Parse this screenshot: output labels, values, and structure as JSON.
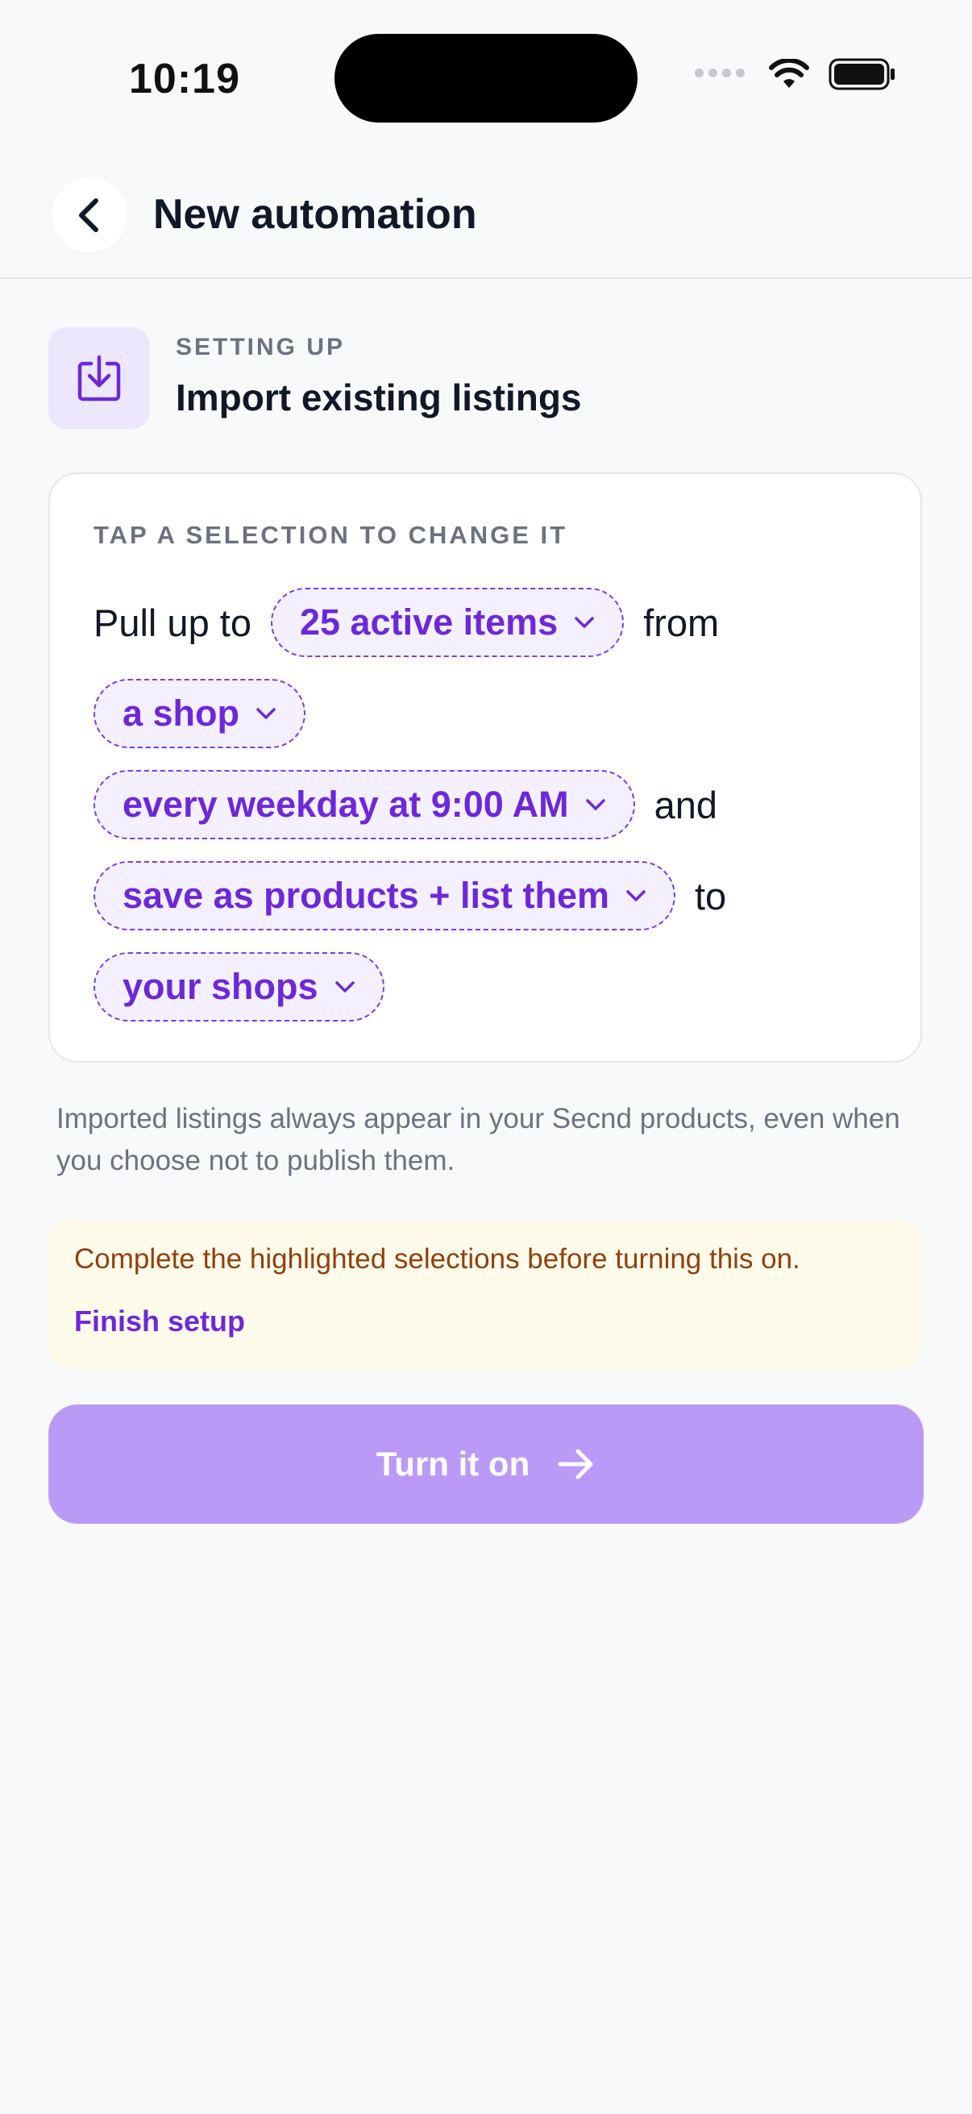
{
  "status_bar": {
    "time": "10:19"
  },
  "header": {
    "title": "New automation"
  },
  "setup": {
    "eyebrow": "SETTING UP",
    "title": "Import existing listings"
  },
  "card": {
    "eyebrow": "TAP A SELECTION TO CHANGE IT",
    "sentence": {
      "prefix": "Pull up to",
      "quantity": "25 active items",
      "from_word": "from",
      "source": "a shop",
      "schedule": "every weekday at 9:00 AM",
      "and_word": "and",
      "action": "save as products + list them",
      "to_word": "to",
      "destination": "your shops"
    }
  },
  "note": "Imported listings always appear in your Secnd products, even when you choose not to publish them.",
  "warning": {
    "text": "Complete the highlighted selections before turning this on.",
    "link": "Finish setup"
  },
  "cta": {
    "label": "Turn it on"
  },
  "colors": {
    "accent": "#6d28d9",
    "chip_bg": "#f4f0ff",
    "cta_disabled": "#bb9af7",
    "warning_bg": "#fffbeb",
    "warning_text": "#92400e"
  },
  "icons": {
    "back": "chevron-left-icon",
    "setup": "download-tray-icon",
    "chip": "chevron-down-icon",
    "cta": "arrow-right-icon"
  }
}
